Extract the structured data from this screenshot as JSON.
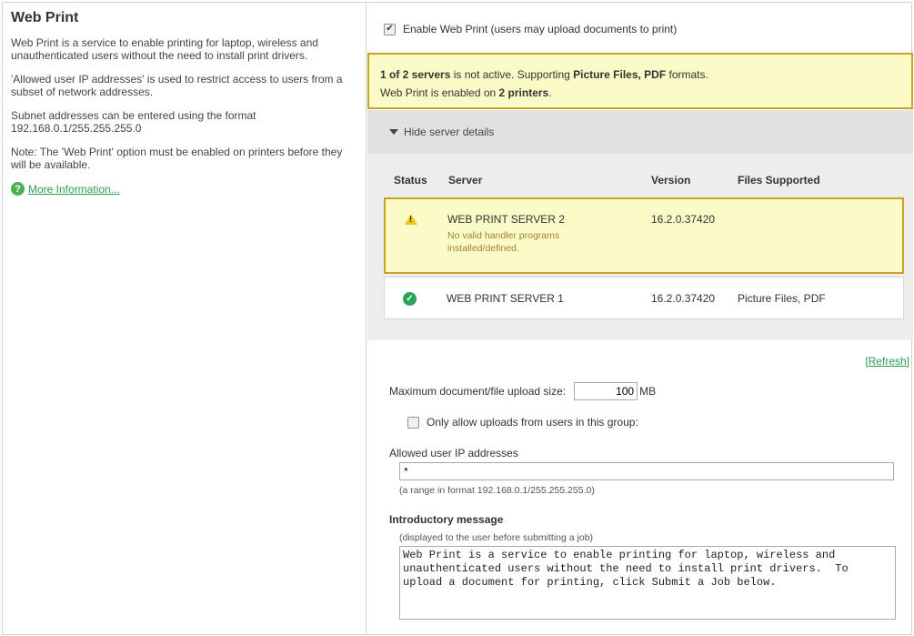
{
  "left": {
    "title": "Web Print",
    "para1": "Web Print is a service to enable printing for laptop, wireless and unauthenticated users without the need to install print drivers.",
    "para2": "'Allowed user IP addresses' is used to restrict access to users from a subset of network addresses.",
    "para3": "Subnet addresses can be entered using the format 192.168.0.1/255.255.255.0",
    "para4": "Note: The 'Web Print' option must be enabled on printers before they will be available.",
    "more_link": "More Information..."
  },
  "enable": {
    "label": "Enable Web Print (users may upload documents to print)",
    "checked": true
  },
  "alert": {
    "servers_count": "1 of 2 servers",
    "not_active": " is not active. Supporting ",
    "formats": "Picture Files, PDF",
    "formats_suffix": " formats.",
    "enabled_prefix": "Web Print is enabled on ",
    "printers": "2 printers",
    "enabled_suffix": "."
  },
  "details": {
    "toggle_label": "Hide server details",
    "columns": {
      "status": "Status",
      "server": "Server",
      "version": "Version",
      "files": "Files Supported"
    },
    "servers": [
      {
        "status": "warning",
        "name": "WEB PRINT SERVER 2",
        "note": "No valid handler programs installed/defined.",
        "version": "16.2.0.37420",
        "files": ""
      },
      {
        "status": "ok",
        "name": "WEB PRINT SERVER 1",
        "note": "",
        "version": "16.2.0.37420",
        "files": "Picture Files, PDF"
      }
    ]
  },
  "refresh_label": "[Refresh]",
  "upload": {
    "label": "Maximum document/file upload size:",
    "value": "100",
    "unit": "MB"
  },
  "group": {
    "label": "Only allow uploads from users in this group:",
    "checked": false
  },
  "ip": {
    "label": "Allowed user IP addresses",
    "value": "*",
    "hint": "(a range in format 192.168.0.1/255.255.255.0)"
  },
  "intro": {
    "label": "Introductory message",
    "hint": "(displayed to the user before submitting a job)",
    "text": "Web Print is a service to enable printing for laptop, wireless and\nunauthenticated users without the need to install print drivers.  To\nupload a document for printing, click Submit a Job below."
  },
  "colors": {
    "link": "#2e9c57",
    "alert_bg": "#fbfbc8",
    "alert_border": "#c9a423",
    "ok": "#2aa55a",
    "warn": "#f0c419"
  }
}
